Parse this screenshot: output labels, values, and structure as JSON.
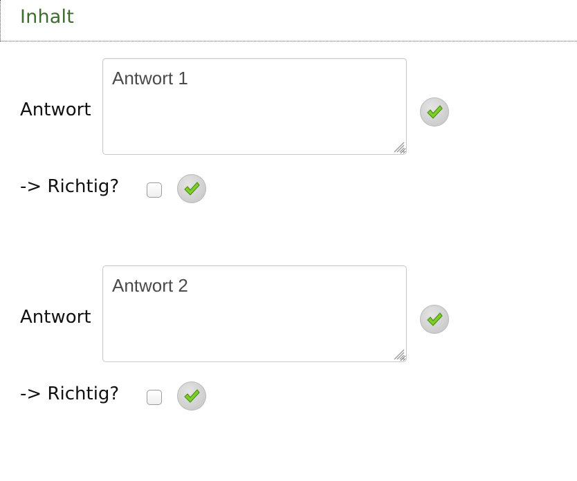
{
  "header": {
    "title": "Inhalt"
  },
  "answers": [
    {
      "label": "Antwort",
      "value": "Antwort 1",
      "correct_label": "-> Richtig?",
      "correct_checked": false
    },
    {
      "label": "Antwort",
      "value": "Antwort 2",
      "correct_label": "-> Richtig?",
      "correct_checked": false
    }
  ],
  "icons": {
    "confirm": "checkmark-icon",
    "resize": "resize-grip-icon"
  },
  "colors": {
    "header_title": "#3f6b2f",
    "checkmark": "#7ccf2a"
  }
}
